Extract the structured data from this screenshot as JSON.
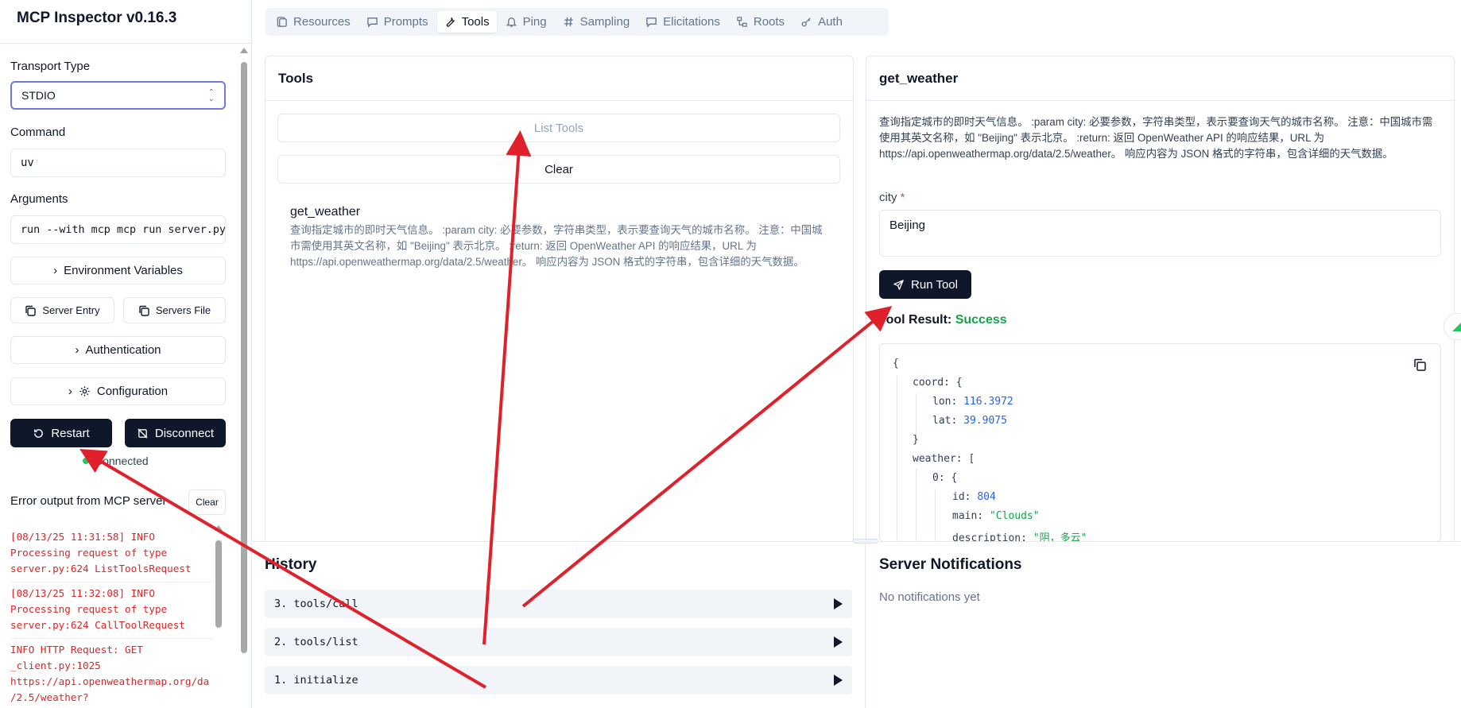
{
  "app": {
    "title": "MCP Inspector v0.16.3"
  },
  "sidebar": {
    "transport_label": "Transport Type",
    "transport_value": "STDIO",
    "command_label": "Command",
    "command_value": "uv",
    "arguments_label": "Arguments",
    "arguments_value": "run --with mcp mcp run server.py",
    "env_vars_button": "Environment Variables",
    "server_entry_button": "Server Entry",
    "servers_file_button": "Servers File",
    "auth_button": "Authentication",
    "config_button": "Configuration",
    "restart_button": "Restart",
    "disconnect_button": "Disconnect",
    "status_text": "Connected",
    "status_color": "#22c55e",
    "error_title": "Error output from MCP server",
    "error_clear": "Clear",
    "error_entries": [
      "[08/13/25 11:31:58] INFO\nProcessing request of type\nserver.py:624 ListToolsRequest",
      "[08/13/25 11:32:08] INFO\nProcessing request of type\nserver.py:624 CallToolRequest",
      "INFO HTTP Request: GET\n_client.py:1025\nhttps://api.openweathermap.org/da\n/2.5/weather?"
    ]
  },
  "tabs": [
    {
      "label": "Resources",
      "icon": "resources-icon",
      "active": false
    },
    {
      "label": "Prompts",
      "icon": "prompts-icon",
      "active": false
    },
    {
      "label": "Tools",
      "icon": "tools-icon",
      "active": true
    },
    {
      "label": "Ping",
      "icon": "bell-icon",
      "active": false
    },
    {
      "label": "Sampling",
      "icon": "hash-icon",
      "active": false
    },
    {
      "label": "Elicitations",
      "icon": "message-icon",
      "active": false
    },
    {
      "label": "Roots",
      "icon": "roots-icon",
      "active": false
    },
    {
      "label": "Auth",
      "icon": "key-icon",
      "active": false
    }
  ],
  "tools_panel": {
    "title": "Tools",
    "list_button": "List Tools",
    "clear_button": "Clear",
    "tool_name": "get_weather",
    "tool_description": "查询指定城市的即时天气信息。 :param city: 必要参数，字符串类型，表示要查询天气的城市名称。 注意：中国城市需使用其英文名称，如 \"Beijing\" 表示北京。 :return: 返回 OpenWeather API 的响应结果，URL 为 https://api.openweathermap.org/data/2.5/weather。 响应内容为 JSON 格式的字符串，包含详细的天气数据。"
  },
  "detail_panel": {
    "title": "get_weather",
    "description": "查询指定城市的即时天气信息。 :param city: 必要参数，字符串类型，表示要查询天气的城市名称。 注意：中国城市需使用其英文名称，如 \"Beijing\" 表示北京。 :return: 返回 OpenWeather API 的响应结果，URL 为 https://api.openweathermap.org/data/2.5/weather。 响应内容为 JSON 格式的字符串，包含详细的天气数据。",
    "param_label": "city",
    "param_required_mark": "*",
    "param_value": "Beijing",
    "run_button": "Run Tool",
    "result_label": "Tool Result:",
    "result_status": "Success",
    "result_color": "#16a34a",
    "json": {
      "open": "{",
      "coord_key": "coord:",
      "coord_open": "{",
      "lon_key": "lon:",
      "lon_val": "116.3972",
      "lat_key": "lat:",
      "lat_val": "39.9075",
      "coord_close": "}",
      "weather_key": "weather:",
      "weather_open": "[",
      "idx_key": "0:",
      "idx_open": "{",
      "id_key": "id:",
      "id_val": "804",
      "main_key": "main:",
      "main_val": "\"Clouds\"",
      "desc_key": "description:",
      "desc_val": "\"阴，多云\""
    }
  },
  "history": {
    "title": "History",
    "items": [
      "3. tools/call",
      "2. tools/list",
      "1. initialize"
    ]
  },
  "notifications": {
    "title": "Server Notifications",
    "empty_text": "No notifications yet"
  },
  "annotation_color": "#e0202a"
}
